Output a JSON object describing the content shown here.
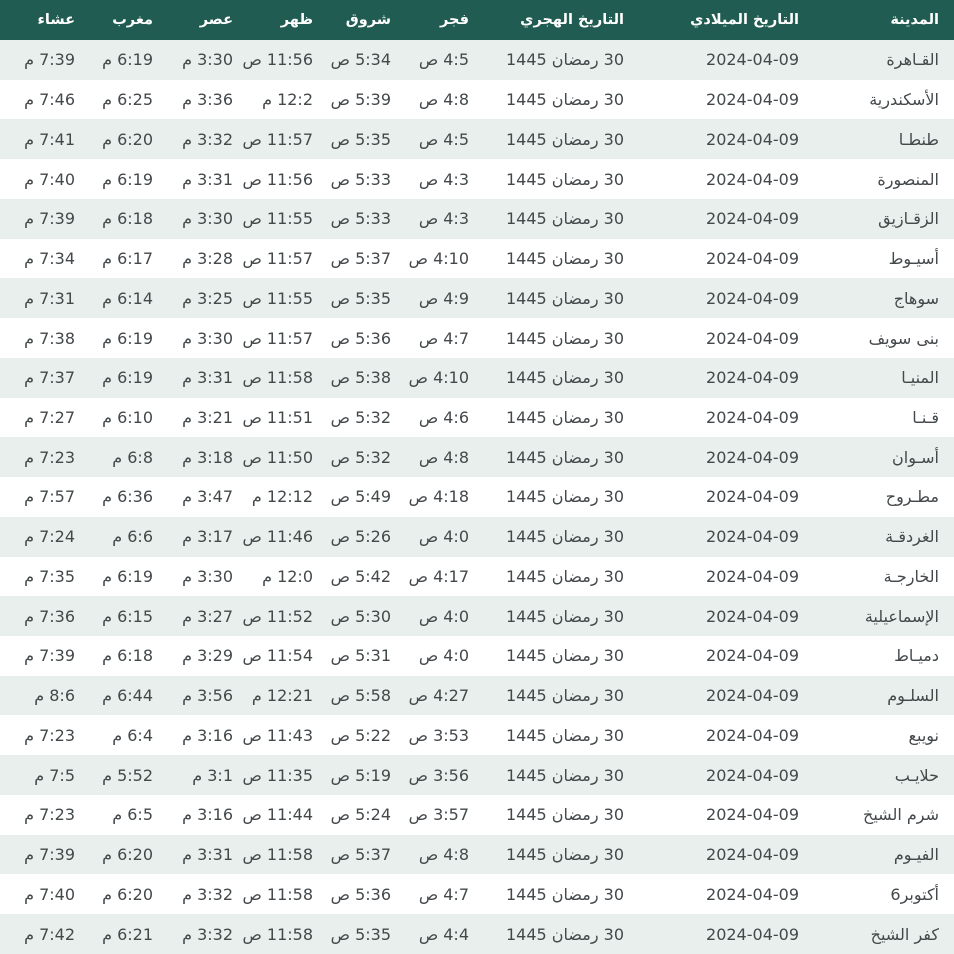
{
  "colors": {
    "header_bg": "#215c52",
    "header_text": "#ffffff",
    "row_alt_bg": "#e9efec",
    "row_bg": "#ffffff",
    "body_text": "#43484b"
  },
  "table": {
    "columns": [
      {
        "key": "city",
        "label": "المدينة"
      },
      {
        "key": "gregorian",
        "label": "التاريخ الميلادي"
      },
      {
        "key": "hijri",
        "label": "التاريخ الهجري"
      },
      {
        "key": "fajr",
        "label": "فجر"
      },
      {
        "key": "sunrise",
        "label": "شروق"
      },
      {
        "key": "dhuhr",
        "label": "ظهر"
      },
      {
        "key": "asr",
        "label": "عصر"
      },
      {
        "key": "maghrib",
        "label": "مغرب"
      },
      {
        "key": "isha",
        "label": "عشاء"
      }
    ],
    "rows": [
      {
        "city": "القـاهرة",
        "gregorian": "2024-04-09",
        "hijri": "30 رمضان 1445",
        "fajr": "4:5 ص",
        "sunrise": "5:34 ص",
        "dhuhr": "11:56 ص",
        "asr": "3:30 م",
        "maghrib": "6:19 م",
        "isha": "7:39 م"
      },
      {
        "city": "الأسكندرية",
        "gregorian": "2024-04-09",
        "hijri": "30 رمضان 1445",
        "fajr": "4:8 ص",
        "sunrise": "5:39 ص",
        "dhuhr": "12:2 م",
        "asr": "3:36 م",
        "maghrib": "6:25 م",
        "isha": "7:46 م"
      },
      {
        "city": "طنطـا",
        "gregorian": "2024-04-09",
        "hijri": "30 رمضان 1445",
        "fajr": "4:5 ص",
        "sunrise": "5:35 ص",
        "dhuhr": "11:57 ص",
        "asr": "3:32 م",
        "maghrib": "6:20 م",
        "isha": "7:41 م"
      },
      {
        "city": "المنصورة",
        "gregorian": "2024-04-09",
        "hijri": "30 رمضان 1445",
        "fajr": "4:3 ص",
        "sunrise": "5:33 ص",
        "dhuhr": "11:56 ص",
        "asr": "3:31 م",
        "maghrib": "6:19 م",
        "isha": "7:40 م"
      },
      {
        "city": "الزقـازيق",
        "gregorian": "2024-04-09",
        "hijri": "30 رمضان 1445",
        "fajr": "4:3 ص",
        "sunrise": "5:33 ص",
        "dhuhr": "11:55 ص",
        "asr": "3:30 م",
        "maghrib": "6:18 م",
        "isha": "7:39 م"
      },
      {
        "city": "أسيـوط",
        "gregorian": "2024-04-09",
        "hijri": "30 رمضان 1445",
        "fajr": "4:10 ص",
        "sunrise": "5:37 ص",
        "dhuhr": "11:57 ص",
        "asr": "3:28 م",
        "maghrib": "6:17 م",
        "isha": "7:34 م"
      },
      {
        "city": "سوهاج",
        "gregorian": "2024-04-09",
        "hijri": "30 رمضان 1445",
        "fajr": "4:9 ص",
        "sunrise": "5:35 ص",
        "dhuhr": "11:55 ص",
        "asr": "3:25 م",
        "maghrib": "6:14 م",
        "isha": "7:31 م"
      },
      {
        "city": "بنى سويف",
        "gregorian": "2024-04-09",
        "hijri": "30 رمضان 1445",
        "fajr": "4:7 ص",
        "sunrise": "5:36 ص",
        "dhuhr": "11:57 ص",
        "asr": "3:30 م",
        "maghrib": "6:19 م",
        "isha": "7:38 م"
      },
      {
        "city": "المنيـا",
        "gregorian": "2024-04-09",
        "hijri": "30 رمضان 1445",
        "fajr": "4:10 ص",
        "sunrise": "5:38 ص",
        "dhuhr": "11:58 ص",
        "asr": "3:31 م",
        "maghrib": "6:19 م",
        "isha": "7:37 م"
      },
      {
        "city": "قـنـا",
        "gregorian": "2024-04-09",
        "hijri": "30 رمضان 1445",
        "fajr": "4:6 ص",
        "sunrise": "5:32 ص",
        "dhuhr": "11:51 ص",
        "asr": "3:21 م",
        "maghrib": "6:10 م",
        "isha": "7:27 م"
      },
      {
        "city": "أسـوان",
        "gregorian": "2024-04-09",
        "hijri": "30 رمضان 1445",
        "fajr": "4:8 ص",
        "sunrise": "5:32 ص",
        "dhuhr": "11:50 ص",
        "asr": "3:18 م",
        "maghrib": "6:8 م",
        "isha": "7:23 م"
      },
      {
        "city": "مطـروح",
        "gregorian": "2024-04-09",
        "hijri": "30 رمضان 1445",
        "fajr": "4:18 ص",
        "sunrise": "5:49 ص",
        "dhuhr": "12:12 م",
        "asr": "3:47 م",
        "maghrib": "6:36 م",
        "isha": "7:57 م"
      },
      {
        "city": "الغردقـة",
        "gregorian": "2024-04-09",
        "hijri": "30 رمضان 1445",
        "fajr": "4:0 ص",
        "sunrise": "5:26 ص",
        "dhuhr": "11:46 ص",
        "asr": "3:17 م",
        "maghrib": "6:6 م",
        "isha": "7:24 م"
      },
      {
        "city": "الخارجـة",
        "gregorian": "2024-04-09",
        "hijri": "30 رمضان 1445",
        "fajr": "4:17 ص",
        "sunrise": "5:42 ص",
        "dhuhr": "12:0 م",
        "asr": "3:30 م",
        "maghrib": "6:19 م",
        "isha": "7:35 م"
      },
      {
        "city": "الإسماعيلية",
        "gregorian": "2024-04-09",
        "hijri": "30 رمضان 1445",
        "fajr": "4:0 ص",
        "sunrise": "5:30 ص",
        "dhuhr": "11:52 ص",
        "asr": "3:27 م",
        "maghrib": "6:15 م",
        "isha": "7:36 م"
      },
      {
        "city": "دميـاط",
        "gregorian": "2024-04-09",
        "hijri": "30 رمضان 1445",
        "fajr": "4:0 ص",
        "sunrise": "5:31 ص",
        "dhuhr": "11:54 ص",
        "asr": "3:29 م",
        "maghrib": "6:18 م",
        "isha": "7:39 م"
      },
      {
        "city": "السلـوم",
        "gregorian": "2024-04-09",
        "hijri": "30 رمضان 1445",
        "fajr": "4:27 ص",
        "sunrise": "5:58 ص",
        "dhuhr": "12:21 م",
        "asr": "3:56 م",
        "maghrib": "6:44 م",
        "isha": "8:6 م"
      },
      {
        "city": "نويبع",
        "gregorian": "2024-04-09",
        "hijri": "30 رمضان 1445",
        "fajr": "3:53 ص",
        "sunrise": "5:22 ص",
        "dhuhr": "11:43 ص",
        "asr": "3:16 م",
        "maghrib": "6:4 م",
        "isha": "7:23 م"
      },
      {
        "city": "حلايـب",
        "gregorian": "2024-04-09",
        "hijri": "30 رمضان 1445",
        "fajr": "3:56 ص",
        "sunrise": "5:19 ص",
        "dhuhr": "11:35 ص",
        "asr": "3:1 م",
        "maghrib": "5:52 م",
        "isha": "7:5 م"
      },
      {
        "city": "شرم الشيخ",
        "gregorian": "2024-04-09",
        "hijri": "30 رمضان 1445",
        "fajr": "3:57 ص",
        "sunrise": "5:24 ص",
        "dhuhr": "11:44 ص",
        "asr": "3:16 م",
        "maghrib": "6:5 م",
        "isha": "7:23 م"
      },
      {
        "city": "الفيـوم",
        "gregorian": "2024-04-09",
        "hijri": "30 رمضان 1445",
        "fajr": "4:8 ص",
        "sunrise": "5:37 ص",
        "dhuhr": "11:58 ص",
        "asr": "3:31 م",
        "maghrib": "6:20 م",
        "isha": "7:39 م"
      },
      {
        "city": "6أكتوبر",
        "gregorian": "2024-04-09",
        "hijri": "30 رمضان 1445",
        "fajr": "4:7 ص",
        "sunrise": "5:36 ص",
        "dhuhr": "11:58 ص",
        "asr": "3:32 م",
        "maghrib": "6:20 م",
        "isha": "7:40 م"
      },
      {
        "city": "كفر الشيخ",
        "gregorian": "2024-04-09",
        "hijri": "30 رمضان 1445",
        "fajr": "4:4 ص",
        "sunrise": "5:35 ص",
        "dhuhr": "11:58 ص",
        "asr": "3:32 م",
        "maghrib": "6:21 م",
        "isha": "7:42 م"
      }
    ]
  }
}
